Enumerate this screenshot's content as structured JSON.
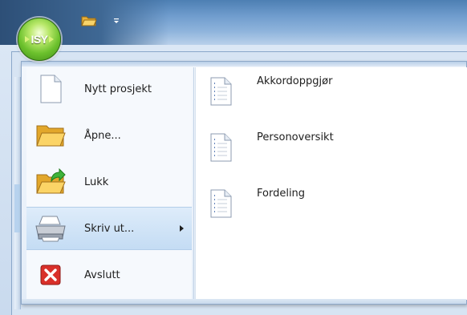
{
  "app": {
    "orb_label": "ISY"
  },
  "menu": {
    "items": [
      {
        "label": "Nytt prosjekt",
        "icon": "new-document-icon"
      },
      {
        "label": "Åpne...",
        "icon": "open-folder-icon"
      },
      {
        "label": "Lukk",
        "icon": "close-folder-icon"
      },
      {
        "label": "Skriv ut...",
        "icon": "printer-icon"
      },
      {
        "label": "Avslutt",
        "icon": "exit-icon"
      }
    ],
    "selected_index": 3,
    "submenu": {
      "items": [
        {
          "label": "Akkordoppgjør",
          "icon": "report-document-icon"
        },
        {
          "label": "Personoversikt",
          "icon": "report-document-icon"
        },
        {
          "label": "Fordeling",
          "icon": "report-document-icon"
        }
      ]
    }
  },
  "colors": {
    "accent": "#6cc12d",
    "selection": "#c4dcf4",
    "exit_red": "#d9302a"
  }
}
